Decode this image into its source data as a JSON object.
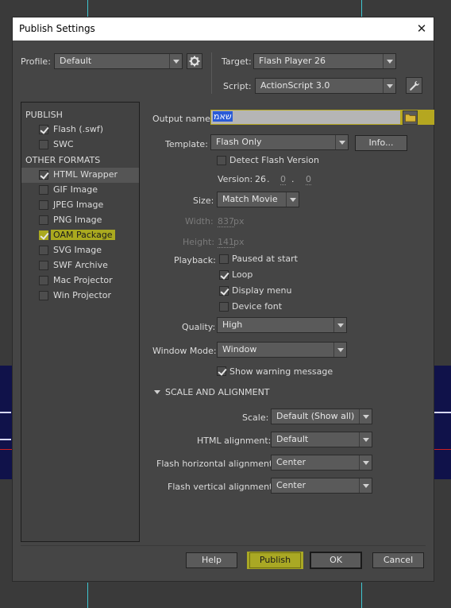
{
  "dialog": {
    "title": "Publish Settings"
  },
  "profile": {
    "label": "Profile:",
    "value": "Default"
  },
  "target": {
    "label": "Target:",
    "value": "Flash Player 26"
  },
  "script": {
    "label": "Script:",
    "value": "ActionScript 3.0"
  },
  "sidebar": {
    "publish_header": "PUBLISH",
    "other_header": "OTHER FORMATS",
    "publish_items": [
      {
        "label": "Flash (.swf)",
        "checked": true
      },
      {
        "label": "SWC",
        "checked": false
      }
    ],
    "other_items": [
      {
        "label": "HTML Wrapper",
        "checked": true
      },
      {
        "label": "GIF Image",
        "checked": false
      },
      {
        "label": "JPEG Image",
        "checked": false
      },
      {
        "label": "PNG Image",
        "checked": false
      },
      {
        "label": "OAM Package",
        "checked": true
      },
      {
        "label": "SVG Image",
        "checked": false
      },
      {
        "label": "SWF Archive",
        "checked": false
      },
      {
        "label": "Mac Projector",
        "checked": false
      },
      {
        "label": "Win Projector",
        "checked": false
      }
    ]
  },
  "output": {
    "label": "Output name:",
    "value": "שאמ"
  },
  "template": {
    "label": "Template:",
    "value": "Flash Only",
    "info_label": "Info..."
  },
  "detect": {
    "label": "Detect Flash Version",
    "checked": false
  },
  "version": {
    "label": "Version:",
    "major": "26",
    "minor": "0",
    "revision": "0"
  },
  "size": {
    "label": "Size:",
    "value": "Match Movie"
  },
  "width": {
    "label": "Width:",
    "value": "837",
    "unit": "px"
  },
  "height": {
    "label": "Height:",
    "value": "141",
    "unit": "px"
  },
  "playback": {
    "label": "Playback:",
    "options": [
      {
        "label": "Paused at start",
        "checked": false
      },
      {
        "label": "Loop",
        "checked": true
      },
      {
        "label": "Display menu",
        "checked": true
      },
      {
        "label": "Device font",
        "checked": false
      }
    ]
  },
  "quality": {
    "label": "Quality:",
    "value": "High"
  },
  "window_mode": {
    "label": "Window Mode:",
    "value": "Window"
  },
  "show_warning": {
    "label": "Show warning message",
    "checked": true
  },
  "scale_section": {
    "label": "SCALE AND ALIGNMENT"
  },
  "scale": {
    "label": "Scale:",
    "value": "Default (Show all)"
  },
  "html_align": {
    "label": "HTML alignment:",
    "value": "Default"
  },
  "flash_h_align": {
    "label": "Flash horizontal alignment:",
    "value": "Center"
  },
  "flash_v_align": {
    "label": "Flash vertical alignment:",
    "value": "Center"
  },
  "buttons": {
    "help": "Help",
    "publish": "Publish",
    "ok": "OK",
    "cancel": "Cancel"
  }
}
